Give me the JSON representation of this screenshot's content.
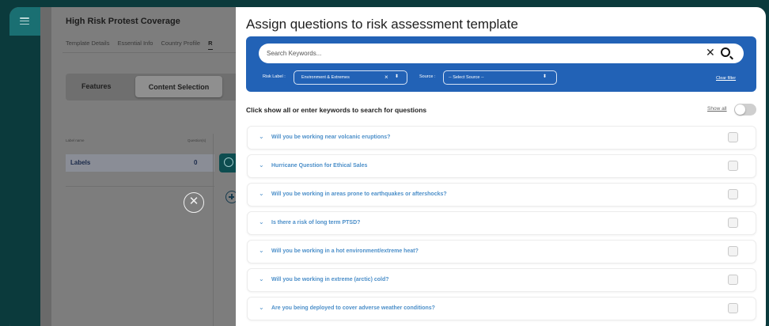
{
  "background_page": {
    "title": "High Risk Protest Coverage",
    "tabs": [
      "Template Details",
      "Essential Info",
      "Country Profile",
      "R"
    ],
    "segment": {
      "features": "Features",
      "content_selection": "Content Selection"
    },
    "table": {
      "headers": [
        "Label name",
        "Question(s)"
      ],
      "rows": [
        {
          "name": "Labels",
          "count": "0"
        }
      ]
    }
  },
  "modal": {
    "title": "Assign questions to risk assessment template",
    "search": {
      "placeholder": "Search Keywords..."
    },
    "risk_label": {
      "label": "Risk Label :",
      "value": "Environment & Extremes"
    },
    "source": {
      "label": "Source :",
      "value": "-- Select Source --"
    },
    "clear_filter": "Clear filter",
    "instruction": "Click show all or enter keywords to search for questions",
    "show_all_label": "Show all",
    "show_all_on": false,
    "questions": [
      "Will you be working near volcanic eruptions?",
      "Hurricane Question for Ethical Sales",
      "Will you be working in areas prone to earthquakes or aftershocks?",
      "Is there a risk of long term PTSD?",
      "Will you be working in a hot environment/extreme heat?",
      "Will you be working in extreme (arctic) cold?",
      "Are you being deployed to cover adverse weather conditions?"
    ]
  },
  "colors": {
    "accent": "#2262b6",
    "question_text": "#4c8fc9",
    "rail": "#0b3a3c"
  },
  "icons": [
    "menu-icon",
    "close-icon",
    "search-icon",
    "chevron-down-icon",
    "plus-circle-icon",
    "info-icon"
  ]
}
